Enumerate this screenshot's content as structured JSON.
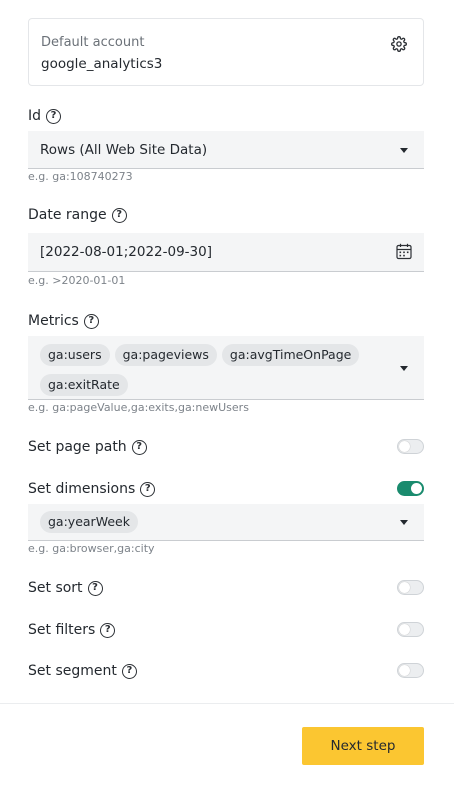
{
  "account": {
    "label": "Default account",
    "value": "google_analytics3"
  },
  "id_field": {
    "label": "Id",
    "value": "Rows (All Web Site Data)",
    "hint": "e.g. ga:108740273"
  },
  "date_range": {
    "label": "Date range",
    "value": "[2022-08-01;2022-09-30]",
    "hint": "e.g. >2020-01-01"
  },
  "metrics": {
    "label": "Metrics",
    "chips": [
      "ga:users",
      "ga:pageviews",
      "ga:avgTimeOnPage",
      "ga:exitRate"
    ],
    "hint": "e.g. ga:pageValue,ga:exits,ga:newUsers"
  },
  "page_path": {
    "label": "Set page path",
    "enabled": false
  },
  "dimensions": {
    "label": "Set dimensions",
    "enabled": true,
    "chips": [
      "ga:yearWeek"
    ],
    "hint": "e.g. ga:browser,ga:city"
  },
  "sort": {
    "label": "Set sort",
    "enabled": false
  },
  "filters": {
    "label": "Set filters",
    "enabled": false
  },
  "segment": {
    "label": "Set segment",
    "enabled": false
  },
  "footer": {
    "next_label": "Next step"
  },
  "colors": {
    "accent": "#fbc631",
    "toggle_on": "#1a8b6e"
  },
  "icons": {
    "settings": "gear-icon",
    "help": "help-circle-icon",
    "date": "calendar-icon",
    "dropdown": "chevron-down-icon"
  }
}
